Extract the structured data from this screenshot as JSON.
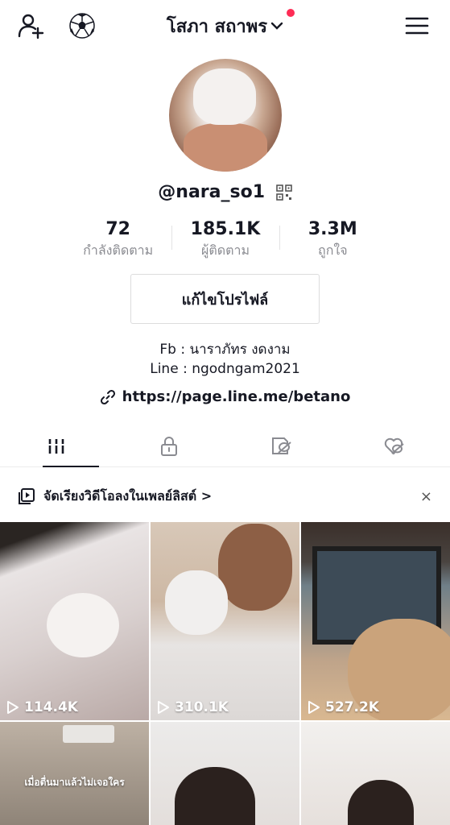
{
  "header": {
    "title": "โสภา สถาพร",
    "add_friend_icon": "person-plus-icon",
    "soccer_icon": "soccer-ball-icon",
    "menu_icon": "hamburger-menu-icon"
  },
  "profile": {
    "username": "@nara_so1",
    "stats": [
      {
        "value": "72",
        "label": "กำลังติดตาม"
      },
      {
        "value": "185.1K",
        "label": "ผู้ติดตาม"
      },
      {
        "value": "3.3M",
        "label": "ถูกใจ"
      }
    ],
    "edit_button": "แก้ไขโปรไฟล์",
    "bio_line1": "Fb : นาราภัทร งดงาม",
    "bio_line2": "Line : ngodngam2021",
    "link": "https://page.line.me/betano"
  },
  "tabs": [
    {
      "name": "videos",
      "icon": "grid-icon",
      "active": true
    },
    {
      "name": "private",
      "icon": "lock-icon",
      "active": false
    },
    {
      "name": "reposts",
      "icon": "hidden-repost-icon",
      "active": false
    },
    {
      "name": "liked",
      "icon": "hidden-heart-icon",
      "active": false
    }
  ],
  "playlist_banner": {
    "text": "จัดเรียงวิดีโอลงในเพลย์ลิสต์ >",
    "close": "×"
  },
  "videos": [
    {
      "views": "114.4K"
    },
    {
      "views": "310.1K"
    },
    {
      "views": "527.2K"
    },
    {
      "caption": "เมื่อตื่นมาแล้วไม่เจอใคร"
    },
    {},
    {}
  ],
  "colors": {
    "accent": "#fe2c55",
    "text": "#161823",
    "muted": "#8a8b91"
  }
}
